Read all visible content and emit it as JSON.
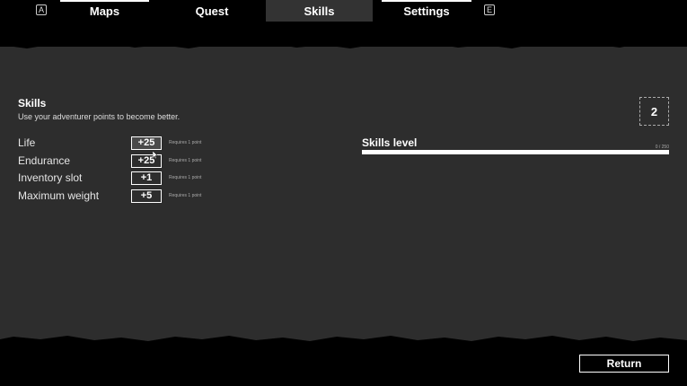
{
  "nav": {
    "left_key": "A",
    "right_key": "E",
    "tabs": [
      {
        "label": "Maps"
      },
      {
        "label": "Quest"
      },
      {
        "label": "Skills"
      },
      {
        "label": "Settings"
      }
    ]
  },
  "skills": {
    "title": "Skills",
    "subtitle": "Use your adventurer points to become better.",
    "items": [
      {
        "label": "Life",
        "bonus": "+25",
        "requirement": "Requires 1 point"
      },
      {
        "label": "Endurance",
        "bonus": "+25",
        "requirement": "Requires 1 point"
      },
      {
        "label": "Inventory slot",
        "bonus": "+1",
        "requirement": "Requires 1 point"
      },
      {
        "label": "Maximum weight",
        "bonus": "+5",
        "requirement": "Requires 1 point"
      }
    ]
  },
  "skills_level": {
    "label": "Skills level",
    "value_text": "0 / 250",
    "progress": 0
  },
  "points": {
    "available": "2"
  },
  "footer": {
    "return_label": "Return"
  },
  "colors": {
    "background": "#000000",
    "panel": "#2d2d2d",
    "active_tab": "#333333",
    "text": "#ffffff"
  }
}
